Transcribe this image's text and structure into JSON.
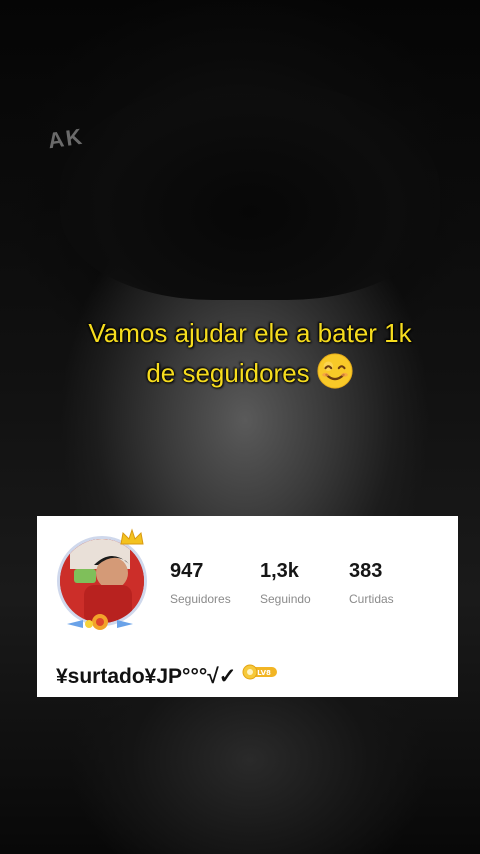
{
  "caption": {
    "line1": "Vamos ajudar ele a bater 1k",
    "line2": "de seguidores"
  },
  "profile": {
    "stats": [
      {
        "value": "947",
        "label": "Seguidores"
      },
      {
        "value": "1,3k",
        "label": "Seguindo"
      },
      {
        "value": "383",
        "label": "Curtidas"
      }
    ],
    "username": "¥surtado¥JP°°°√✓",
    "level_badge": "LV8"
  },
  "colors": {
    "caption": "#f6dc1e",
    "card_bg": "#ffffff",
    "stat_label": "#8b8b8b",
    "level_badge": "#f2b524"
  },
  "icons": [
    "smiling-face-emoji-icon",
    "crown-icon",
    "flower-badge-icon",
    "level-badge-icon"
  ]
}
